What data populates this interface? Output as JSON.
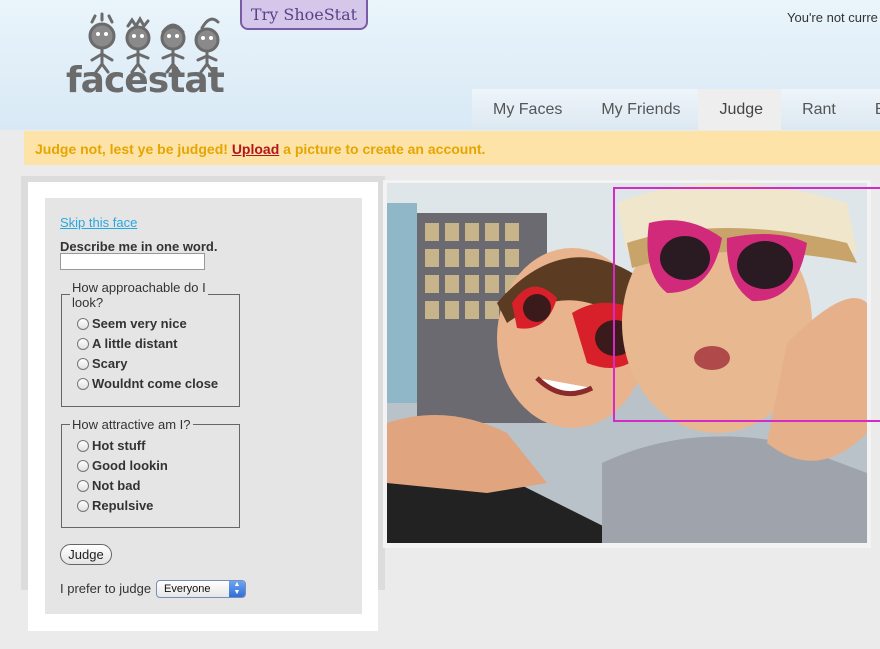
{
  "header": {
    "logo_text": "facestat",
    "try_button": "Try ShoeStat",
    "status": "You're not curre"
  },
  "nav": {
    "tabs": [
      {
        "label": "My Faces",
        "active": false
      },
      {
        "label": "My Friends",
        "active": false
      },
      {
        "label": "Judge",
        "active": true
      },
      {
        "label": "Rant",
        "active": false
      },
      {
        "label": "Br",
        "active": false
      }
    ]
  },
  "banner": {
    "before": "Judge not, lest ye be judged! ",
    "link": "Upload",
    "after": " a picture to create an account."
  },
  "form": {
    "skip_link": "Skip this face",
    "describe_label": "Describe me in one word.",
    "describe_value": "",
    "q1": {
      "legend_line1": "How approachable do I",
      "legend_line2": "look?",
      "options": [
        "Seem very nice",
        "A little distant",
        "Scary",
        "Wouldnt come close"
      ]
    },
    "q2": {
      "legend": "How attractive am I?",
      "options": [
        "Hot stuff",
        "Good lookin",
        "Not bad",
        "Repulsive"
      ]
    },
    "judge_button": "Judge",
    "prefer_label": "I prefer to judge",
    "prefer_value": "Everyone"
  },
  "colors": {
    "banner_bg": "#fde3a7",
    "banner_text": "#e6a500",
    "link_red": "#b3151c",
    "face_box": "#d42ac8",
    "try_bg": "#d5c7ea"
  }
}
